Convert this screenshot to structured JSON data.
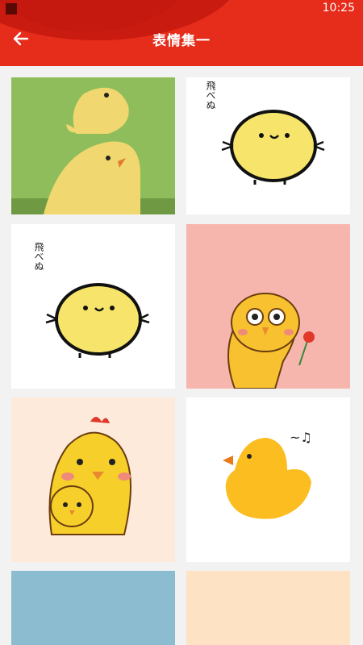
{
  "status_bar": {
    "time": "10:25"
  },
  "header": {
    "title": "表情集一",
    "back_icon": "arrow-left-icon"
  },
  "grid": {
    "items": [
      {
        "name": "stacked-chicks",
        "bg": "#8fbd5b"
      },
      {
        "name": "chick-flying",
        "bg": "#ffffff",
        "caption": "飛べぬ"
      },
      {
        "name": "chick-flying-2",
        "bg": "#ffffff",
        "caption": "飛べぬ"
      },
      {
        "name": "chick-with-flower",
        "bg": "#f7b6ad"
      },
      {
        "name": "hen-and-chick",
        "bg": "#fdeadb"
      },
      {
        "name": "chick-singing",
        "bg": "#ffffff",
        "note": "~♫"
      },
      {
        "name": "blue-card",
        "bg": "#8bbccf"
      },
      {
        "name": "peach-card",
        "bg": "#fde2c3"
      }
    ]
  },
  "colors": {
    "accent": "#e62c1b",
    "chick": "#f7e46b",
    "chick_orange": "#fbbd1f"
  }
}
